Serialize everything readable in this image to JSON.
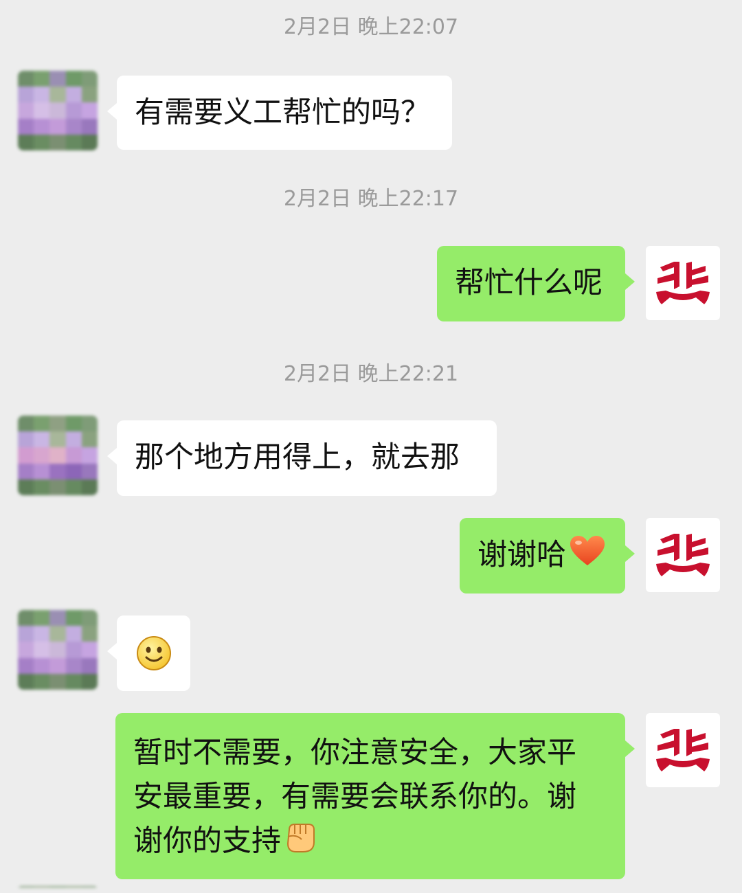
{
  "messages": [
    {
      "timestamp": "2月2日 晚上22:07"
    },
    {
      "text": "有需要义工帮忙的吗？"
    },
    {
      "timestamp": "2月2日 晚上22:17"
    },
    {
      "text": "帮忙什么呢"
    },
    {
      "timestamp": "2月2日 晚上22:21"
    },
    {
      "text": "那个地方用得上，就去那"
    },
    {
      "text": "谢谢哈",
      "emoji": "heart-emoji"
    },
    {
      "emoji": "smile-emoji"
    },
    {
      "lines": [
        "暂时不需要，你注意安全，大家平",
        "安最重要，有需要会联系你的。谢",
        "谢你的支持"
      ],
      "emoji": "fist-emoji"
    }
  ],
  "colors": {
    "background": "#ededed",
    "incoming_bubble": "#ffffff",
    "outgoing_bubble": "#95ec69",
    "timestamp_text": "#9a9a9a",
    "logo_red": "#c8102e"
  }
}
